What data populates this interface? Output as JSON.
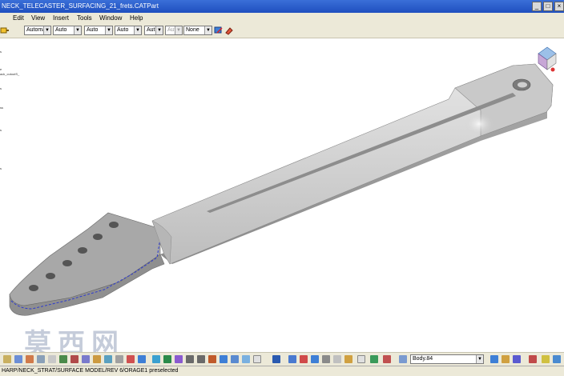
{
  "window": {
    "title": "NECK_TELECASTER_SURFACING_21_frets.CATPart"
  },
  "menu": [
    "Edit",
    "View",
    "Insert",
    "Tools",
    "Window",
    "Help"
  ],
  "toolbar": {
    "combos": [
      "Automa",
      "Auto",
      "Auto",
      "Auto",
      "Aut",
      "Aut",
      "None"
    ]
  },
  "tree": {
    "fragments": [
      "s",
      "",
      "e",
      "ack_cutoutS_",
      "s",
      "ss",
      "s",
      "",
      "s"
    ]
  },
  "bottom": {
    "body_selector": "Body.84"
  },
  "status": {
    "text": "HARP/NECK_STRAT/SURFACE MODEL/REV 6/ORAGE1 preselected"
  },
  "watermark": "莫西网",
  "colors": {
    "titlebar": "#2a5fcc",
    "chrome": "#ece9d8",
    "model_face": "#bdbdbd",
    "highlight": "#2d3bd0"
  },
  "icons": [
    "compass-icon",
    "hide-icon",
    "fit-all-icon",
    "rotate-icon",
    "zoom-icon",
    "normal-view-icon"
  ]
}
